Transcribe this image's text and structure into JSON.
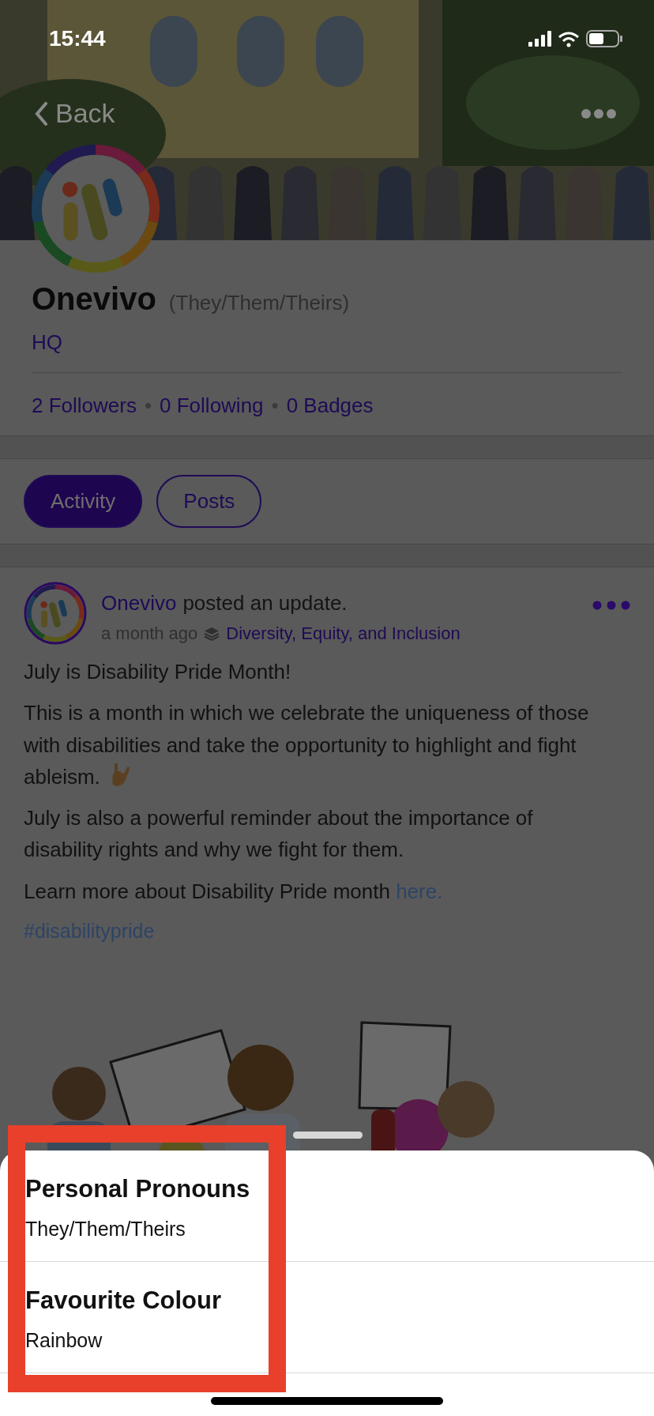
{
  "status_bar": {
    "time": "15:44"
  },
  "nav": {
    "back": "Back"
  },
  "profile": {
    "name": "Onevivo",
    "pronouns": "(They/Them/Theirs)",
    "location": "HQ",
    "separator": "•",
    "stats": [
      "2 Followers",
      "0 Following",
      "0 Badges"
    ]
  },
  "tabs": [
    {
      "label": "Activity",
      "selected": true
    },
    {
      "label": "Posts",
      "selected": false
    }
  ],
  "post": {
    "author": "Onevivo",
    "action": "posted an update.",
    "time": "a month ago",
    "group": "Diversity, Equity, and Inclusion",
    "paragraphs": [
      {
        "text": "July is Disability Pride Month!"
      },
      {
        "text": "This is a month in which we celebrate the uniqueness of those with disabilities and take the opportunity to highlight and fight ableism.",
        "emoji": true
      },
      {
        "text": "July is also a powerful reminder about the importance of disability rights and why we fight for them."
      },
      {
        "text": "Learn more about Disability Pride month ",
        "link": "here."
      }
    ],
    "hashtag": "#disabilitypride"
  },
  "sheet": {
    "fields": [
      {
        "label": "Personal Pronouns",
        "value": "They/Them/Theirs"
      },
      {
        "label": "Favourite Colour",
        "value": "Rainbow"
      }
    ]
  },
  "highlight_frame": true
}
